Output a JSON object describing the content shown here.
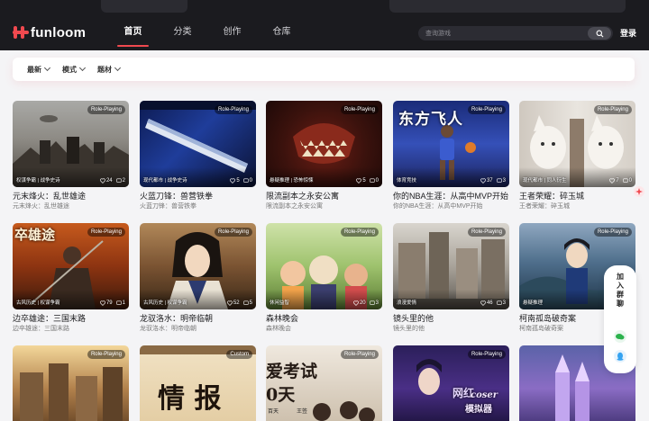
{
  "header": {
    "logo_text": "funloom",
    "nav": [
      "首页",
      "分类",
      "创作",
      "仓库"
    ],
    "active_nav": 0,
    "search_placeholder": "查询游戏",
    "login_label": "登录"
  },
  "filters": [
    "最新",
    "模式",
    "题材"
  ],
  "cards": [
    {
      "title": "元末烽火：乱世雄途",
      "subtitle": "元末烽火：乱世雄途",
      "badge": "Role-Playing",
      "tags": "权谋争霸 | 战争史诗",
      "likes": "24",
      "comments": "2",
      "scene": "war"
    },
    {
      "title": "火蓝刀锋：兽营铁拳",
      "subtitle": "火蓝刀锋：兽营铁拳",
      "badge": "Role-Playing",
      "tags": "现代都市 | 战争史诗",
      "likes": "5",
      "comments": "0",
      "scene": "blade"
    },
    {
      "title": "限流副本之永安公寓",
      "subtitle": "限流副本之永安公寓",
      "badge": "Role-Playing",
      "tags": "悬疑推理 | 恐怖惊悚",
      "likes": "5",
      "comments": "0",
      "scene": "monster"
    },
    {
      "title": "你的NBA生涯：从高中MVP开始",
      "subtitle": "你的NBA生涯：从高中MVP开始",
      "badge": "Role-Playing",
      "tags": "体育竞技",
      "likes": "37",
      "comments": "3",
      "scene": "nba"
    },
    {
      "title": "王者荣耀：碎玉城",
      "subtitle": "王者荣耀：碎玉城",
      "badge": "Role-Playing",
      "tags": "现代都市 | 同人衍生",
      "likes": "7",
      "comments": "0",
      "scene": "cat"
    },
    {
      "title": "边卒雄途：三国末路",
      "subtitle": "边卒雄途：三国末路",
      "badge": "Role-Playing",
      "tags": "古风历史 | 权谋争霸",
      "likes": "79",
      "comments": "1",
      "scene": "warrior"
    },
    {
      "title": "龙驭洛水：明帝临朝",
      "subtitle": "龙驭洛水：明帝临朝",
      "badge": "Role-Playing",
      "tags": "古风历史 | 权谋争霸",
      "likes": "52",
      "comments": "5",
      "scene": "emperor"
    },
    {
      "title": "森林晚会",
      "subtitle": "森林晚会",
      "badge": "Role-Playing",
      "tags": "休闲益智",
      "likes": "20",
      "comments": "3",
      "scene": "forest"
    },
    {
      "title": "镜头里的他",
      "subtitle": "镜头里的他",
      "badge": "Role-Playing",
      "tags": "浪漫爱情",
      "likes": "46",
      "comments": "3",
      "scene": "street"
    },
    {
      "title": "柯南孤岛破奇案",
      "subtitle": "柯南孤岛破奇案",
      "badge": "Role-Playing",
      "tags": "悬疑推理",
      "likes": "",
      "comments": "",
      "scene": "conan"
    },
    {
      "title": "",
      "subtitle": "",
      "badge": "Role-Playing",
      "tags": "",
      "likes": "",
      "comments": "",
      "scene": "city"
    },
    {
      "title": "",
      "subtitle": "",
      "badge": "Custom",
      "tags": "",
      "likes": "",
      "comments": "",
      "scene": "scroll"
    },
    {
      "title": "",
      "subtitle": "",
      "badge": "Role-Playing",
      "tags": "",
      "likes": "",
      "comments": "",
      "scene": "exam"
    },
    {
      "title": "",
      "subtitle": "",
      "badge": "Role-Playing",
      "tags": "",
      "likes": "",
      "comments": "",
      "scene": "cosplay"
    },
    {
      "title": "",
      "subtitle": "",
      "badge": "",
      "tags": "",
      "likes": "",
      "comments": "",
      "scene": "castle"
    }
  ],
  "overlays": {
    "blade_title": "东方飞人",
    "warrior_title": "卒雄途",
    "scroll_title": "情 报",
    "exam_title": "爱考试",
    "exam_days": "0天",
    "exam_footer": "百天",
    "exam_footer2": "王签",
    "cosplay_title": "网红",
    "cosplay_sub": "coser",
    "cosplay_sub2": "模拟器"
  },
  "side": {
    "join_label": "加入群聊",
    "icons": [
      "wechat-icon",
      "qq-icon"
    ]
  },
  "colors": {
    "accent": "#f0494f",
    "header_bg": "#1b1b1f",
    "page_bg": "#f4f4f6",
    "wechat": "#2bb24c",
    "qq": "#35a3f1"
  }
}
